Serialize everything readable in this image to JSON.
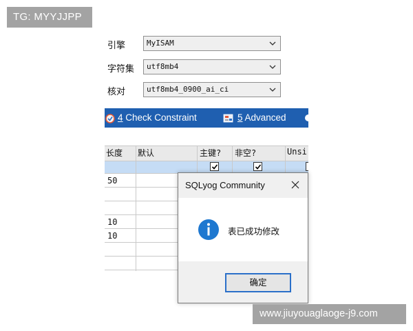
{
  "watermark": {
    "tag": "TG: MYYJJPP",
    "url": "www.jiuyouaglaoge-j9.com"
  },
  "settings": [
    {
      "label": "引擎",
      "value": "MyISAM"
    },
    {
      "label": "字符集",
      "value": "utf8mb4"
    },
    {
      "label": "核对",
      "value": "utf8mb4_0900_ai_ci"
    }
  ],
  "tabs": [
    {
      "num": "4",
      "label": " Check Constraint",
      "icon": "check-constraint-icon"
    },
    {
      "num": "5",
      "label": " Advanced",
      "icon": "advanced-icon"
    }
  ],
  "grid": {
    "headers": [
      "长度",
      "默认",
      "主键?",
      "非空?",
      "Unsi"
    ],
    "rows": [
      {
        "length": "",
        "pk": true,
        "notnull": true,
        "selected": true
      },
      {
        "length": "50"
      },
      {
        "length": ""
      },
      {
        "length": ""
      },
      {
        "length": "10"
      },
      {
        "length": "10"
      },
      {
        "length": ""
      },
      {
        "length": ""
      }
    ]
  },
  "dialog": {
    "title": "SQLyog Community",
    "message": "表已成功修改",
    "ok_label": "确定",
    "icon": "info-icon"
  }
}
